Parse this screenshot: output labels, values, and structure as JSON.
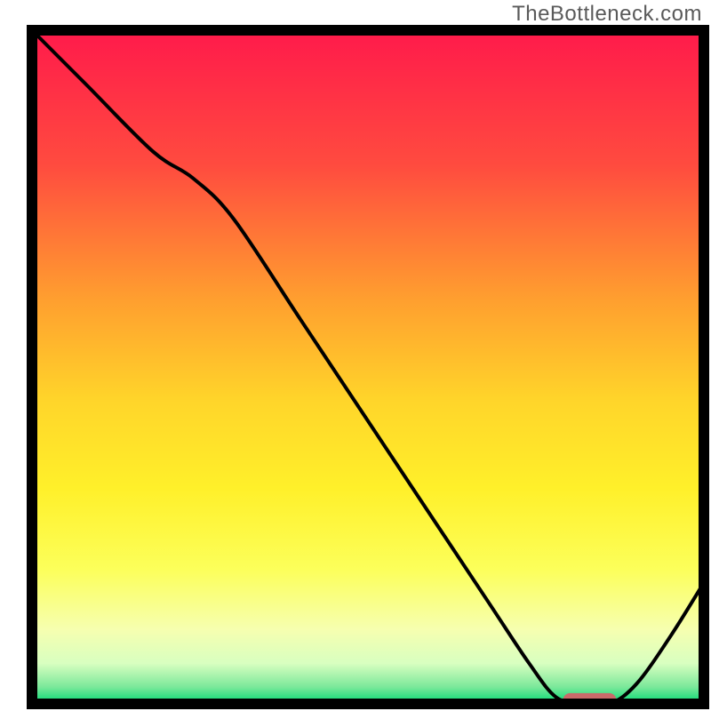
{
  "watermark": "TheBottleneck.com",
  "chart_data": {
    "type": "line",
    "title": "",
    "xlabel": "",
    "ylabel": "",
    "xlim": [
      0,
      100
    ],
    "ylim": [
      0,
      100
    ],
    "background_gradient_stops": [
      {
        "offset": 0.0,
        "color": "#ff1a4b"
      },
      {
        "offset": 0.2,
        "color": "#ff4b3f"
      },
      {
        "offset": 0.4,
        "color": "#ff9f2f"
      },
      {
        "offset": 0.55,
        "color": "#ffd52a"
      },
      {
        "offset": 0.68,
        "color": "#fff02a"
      },
      {
        "offset": 0.8,
        "color": "#fcff5a"
      },
      {
        "offset": 0.89,
        "color": "#f6ffb0"
      },
      {
        "offset": 0.94,
        "color": "#d8ffc0"
      },
      {
        "offset": 0.975,
        "color": "#7be89a"
      },
      {
        "offset": 1.0,
        "color": "#00d973"
      }
    ],
    "series": [
      {
        "name": "bottleneck-curve",
        "color": "#000000",
        "stroke_width": 4,
        "x": [
          0,
          8,
          18,
          24,
          30,
          40,
          50,
          60,
          68,
          74,
          78,
          82,
          86,
          90,
          95,
          100
        ],
        "values": [
          100,
          92,
          82,
          78,
          72,
          57,
          42,
          27,
          15,
          6,
          1,
          0,
          0,
          3,
          10,
          18
        ]
      }
    ],
    "marker": {
      "name": "optimal-range",
      "color": "#c96a6a",
      "x_start": 79,
      "x_end": 87,
      "y": 0.5,
      "height": 2.2
    }
  }
}
